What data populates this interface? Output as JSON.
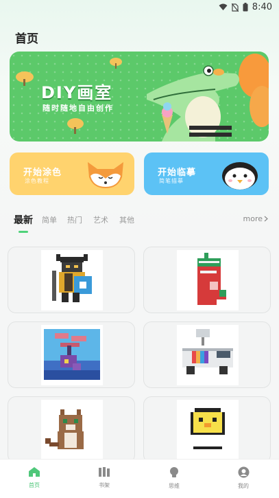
{
  "status_bar": {
    "time": "8:40"
  },
  "header": {
    "title": "首页"
  },
  "banner": {
    "title": "DIY画室",
    "subtitle": "随时随地自由创作"
  },
  "cards": [
    {
      "title": "开始涂色",
      "subtitle": "涂色教程"
    },
    {
      "title": "开始临摹",
      "subtitle": "简笔描摹"
    }
  ],
  "tabs": [
    {
      "label": "最新",
      "active": true
    },
    {
      "label": "简单",
      "active": false
    },
    {
      "label": "热门",
      "active": false
    },
    {
      "label": "艺术",
      "active": false
    },
    {
      "label": "其他",
      "active": false
    }
  ],
  "more_label": "more",
  "gallery": [
    {
      "icon": "viking-knight-pixel-art"
    },
    {
      "icon": "christmas-stocking-pixel-art"
    },
    {
      "icon": "tree-house-pixel-art"
    },
    {
      "icon": "news-van-pixel-art"
    },
    {
      "icon": "cat-pixel-art"
    },
    {
      "icon": "chick-in-egg-pixel-art"
    }
  ],
  "bottom_nav": [
    {
      "label": "首页",
      "icon": "home-icon",
      "active": true
    },
    {
      "label": "书架",
      "icon": "bookshelf-icon",
      "active": false
    },
    {
      "label": "思维",
      "icon": "lightbulb-icon",
      "active": false
    },
    {
      "label": "我的",
      "icon": "profile-icon",
      "active": false
    }
  ],
  "colors": {
    "accent": "#4fd27a",
    "banner_green": "#5cc96a",
    "coloring_yellow": "#ffd36e",
    "copy_blue": "#5cc2f5"
  }
}
